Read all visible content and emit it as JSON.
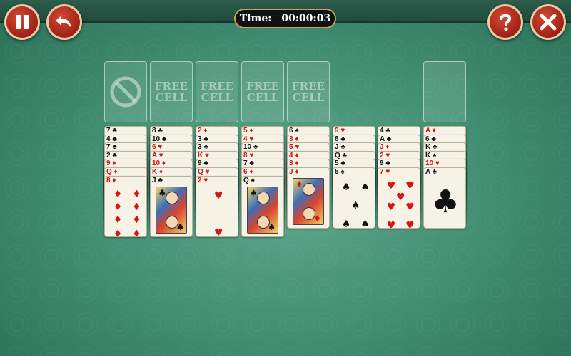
{
  "toolbar": {
    "pause_icon": "pause-icon",
    "undo_icon": "undo-arrow-icon",
    "help_icon": "question-mark-icon",
    "close_icon": "x-close-icon",
    "button_color": "#a82718"
  },
  "timer": {
    "label": "Time:",
    "value": "00:00:03"
  },
  "slots": {
    "foundation_empty_icon": "no-symbol-icon",
    "free_cell_label": "FREE\nCELL",
    "free_cells": [
      "FREE\nCELL",
      "FREE\nCELL",
      "FREE\nCELL",
      "FREE\nCELL"
    ]
  },
  "columns": [
    [
      "7♣",
      "4♣",
      "7♣",
      "2♣",
      "9♦",
      "Q♦",
      "8♦"
    ],
    [
      "8♣",
      "10♣",
      "6♥",
      "A♥",
      "10♦",
      "K♦",
      "J♣"
    ],
    [
      "2♦",
      "3♣",
      "3♣",
      "K♥",
      "9♣",
      "Q♥",
      "2♥"
    ],
    [
      "5♦",
      "4♥",
      "10♣",
      "8♥",
      "7♣",
      "6♦",
      "Q♠"
    ],
    [
      "6♠",
      "3♦",
      "5♥",
      "4♦",
      "3♦",
      "J♦"
    ],
    [
      "9♥",
      "8♣",
      "J♣",
      "Q♣",
      "5♣",
      "5♠"
    ],
    [
      "4♣",
      "A♣",
      "J♦",
      "2♥",
      "9♣",
      "7♥"
    ],
    [
      "A♦",
      "6♣",
      "K♣",
      "K♠",
      "10♥",
      "A♣"
    ]
  ],
  "colors": {
    "felt": "#3f8c70",
    "red_suit": "#d41616",
    "black_suit": "#111111",
    "timer_border": "#c9a05a"
  }
}
